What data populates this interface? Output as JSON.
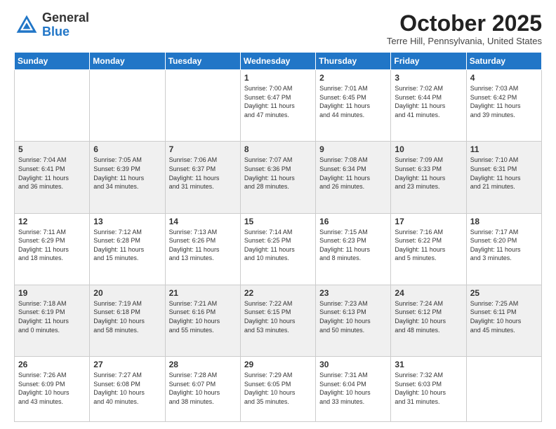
{
  "header": {
    "logo_general": "General",
    "logo_blue": "Blue",
    "month_title": "October 2025",
    "location": "Terre Hill, Pennsylvania, United States"
  },
  "days_of_week": [
    "Sunday",
    "Monday",
    "Tuesday",
    "Wednesday",
    "Thursday",
    "Friday",
    "Saturday"
  ],
  "weeks": [
    [
      {
        "day": "",
        "info": ""
      },
      {
        "day": "",
        "info": ""
      },
      {
        "day": "",
        "info": ""
      },
      {
        "day": "1",
        "info": "Sunrise: 7:00 AM\nSunset: 6:47 PM\nDaylight: 11 hours\nand 47 minutes."
      },
      {
        "day": "2",
        "info": "Sunrise: 7:01 AM\nSunset: 6:45 PM\nDaylight: 11 hours\nand 44 minutes."
      },
      {
        "day": "3",
        "info": "Sunrise: 7:02 AM\nSunset: 6:44 PM\nDaylight: 11 hours\nand 41 minutes."
      },
      {
        "day": "4",
        "info": "Sunrise: 7:03 AM\nSunset: 6:42 PM\nDaylight: 11 hours\nand 39 minutes."
      }
    ],
    [
      {
        "day": "5",
        "info": "Sunrise: 7:04 AM\nSunset: 6:41 PM\nDaylight: 11 hours\nand 36 minutes."
      },
      {
        "day": "6",
        "info": "Sunrise: 7:05 AM\nSunset: 6:39 PM\nDaylight: 11 hours\nand 34 minutes."
      },
      {
        "day": "7",
        "info": "Sunrise: 7:06 AM\nSunset: 6:37 PM\nDaylight: 11 hours\nand 31 minutes."
      },
      {
        "day": "8",
        "info": "Sunrise: 7:07 AM\nSunset: 6:36 PM\nDaylight: 11 hours\nand 28 minutes."
      },
      {
        "day": "9",
        "info": "Sunrise: 7:08 AM\nSunset: 6:34 PM\nDaylight: 11 hours\nand 26 minutes."
      },
      {
        "day": "10",
        "info": "Sunrise: 7:09 AM\nSunset: 6:33 PM\nDaylight: 11 hours\nand 23 minutes."
      },
      {
        "day": "11",
        "info": "Sunrise: 7:10 AM\nSunset: 6:31 PM\nDaylight: 11 hours\nand 21 minutes."
      }
    ],
    [
      {
        "day": "12",
        "info": "Sunrise: 7:11 AM\nSunset: 6:29 PM\nDaylight: 11 hours\nand 18 minutes."
      },
      {
        "day": "13",
        "info": "Sunrise: 7:12 AM\nSunset: 6:28 PM\nDaylight: 11 hours\nand 15 minutes."
      },
      {
        "day": "14",
        "info": "Sunrise: 7:13 AM\nSunset: 6:26 PM\nDaylight: 11 hours\nand 13 minutes."
      },
      {
        "day": "15",
        "info": "Sunrise: 7:14 AM\nSunset: 6:25 PM\nDaylight: 11 hours\nand 10 minutes."
      },
      {
        "day": "16",
        "info": "Sunrise: 7:15 AM\nSunset: 6:23 PM\nDaylight: 11 hours\nand 8 minutes."
      },
      {
        "day": "17",
        "info": "Sunrise: 7:16 AM\nSunset: 6:22 PM\nDaylight: 11 hours\nand 5 minutes."
      },
      {
        "day": "18",
        "info": "Sunrise: 7:17 AM\nSunset: 6:20 PM\nDaylight: 11 hours\nand 3 minutes."
      }
    ],
    [
      {
        "day": "19",
        "info": "Sunrise: 7:18 AM\nSunset: 6:19 PM\nDaylight: 11 hours\nand 0 minutes."
      },
      {
        "day": "20",
        "info": "Sunrise: 7:19 AM\nSunset: 6:18 PM\nDaylight: 10 hours\nand 58 minutes."
      },
      {
        "day": "21",
        "info": "Sunrise: 7:21 AM\nSunset: 6:16 PM\nDaylight: 10 hours\nand 55 minutes."
      },
      {
        "day": "22",
        "info": "Sunrise: 7:22 AM\nSunset: 6:15 PM\nDaylight: 10 hours\nand 53 minutes."
      },
      {
        "day": "23",
        "info": "Sunrise: 7:23 AM\nSunset: 6:13 PM\nDaylight: 10 hours\nand 50 minutes."
      },
      {
        "day": "24",
        "info": "Sunrise: 7:24 AM\nSunset: 6:12 PM\nDaylight: 10 hours\nand 48 minutes."
      },
      {
        "day": "25",
        "info": "Sunrise: 7:25 AM\nSunset: 6:11 PM\nDaylight: 10 hours\nand 45 minutes."
      }
    ],
    [
      {
        "day": "26",
        "info": "Sunrise: 7:26 AM\nSunset: 6:09 PM\nDaylight: 10 hours\nand 43 minutes."
      },
      {
        "day": "27",
        "info": "Sunrise: 7:27 AM\nSunset: 6:08 PM\nDaylight: 10 hours\nand 40 minutes."
      },
      {
        "day": "28",
        "info": "Sunrise: 7:28 AM\nSunset: 6:07 PM\nDaylight: 10 hours\nand 38 minutes."
      },
      {
        "day": "29",
        "info": "Sunrise: 7:29 AM\nSunset: 6:05 PM\nDaylight: 10 hours\nand 35 minutes."
      },
      {
        "day": "30",
        "info": "Sunrise: 7:31 AM\nSunset: 6:04 PM\nDaylight: 10 hours\nand 33 minutes."
      },
      {
        "day": "31",
        "info": "Sunrise: 7:32 AM\nSunset: 6:03 PM\nDaylight: 10 hours\nand 31 minutes."
      },
      {
        "day": "",
        "info": ""
      }
    ]
  ]
}
